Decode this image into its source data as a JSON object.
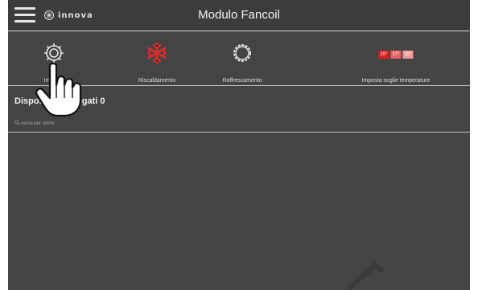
{
  "header": {
    "title": "Modulo Fancoil",
    "logo_text": "innova",
    "menu_icon": "hamburger-menu-icon"
  },
  "toolbar": {
    "items": [
      {
        "label": "Imposta",
        "icon": "gear-icon"
      },
      {
        "label": "Riscaldamento",
        "icon": "snowflake-icon",
        "color": "#e02a2a"
      },
      {
        "label": "Raffrescamento",
        "icon": "sun-icon"
      },
      {
        "label": "Imposta soglie temperature",
        "icon": "temperature-thresholds-icon"
      }
    ],
    "thresholds": [
      "20°",
      "17°",
      "10°"
    ]
  },
  "devices": {
    "title": "Dispositivi collegati 0"
  },
  "search": {
    "placeholder": "cerca per nome"
  },
  "colors": {
    "background": "#444444",
    "accent_red": "#e02a2a"
  }
}
